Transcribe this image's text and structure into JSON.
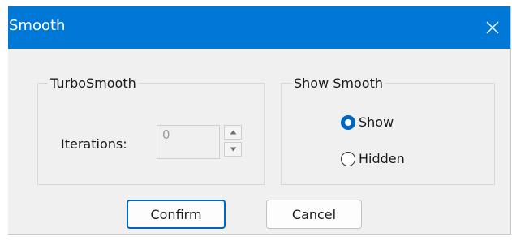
{
  "dialog": {
    "title": "Smooth"
  },
  "turbosmooth": {
    "legend": "TurboSmooth",
    "iterations_label": "Iterations:",
    "iterations_value": "0"
  },
  "show_smooth": {
    "legend": "Show Smooth",
    "options": [
      {
        "label": "Show",
        "selected": true
      },
      {
        "label": "Hidden",
        "selected": false
      }
    ]
  },
  "buttons": {
    "confirm": "Confirm",
    "cancel": "Cancel"
  },
  "colors": {
    "titlebar": "#0078d7",
    "accent": "#0067c0",
    "dialog_bg": "#f0f0f0"
  },
  "icons": {
    "close": "close-icon",
    "spin_up": "triangle-up-icon",
    "spin_down": "triangle-down-icon",
    "radio_on": "radio-checked-icon",
    "radio_off": "radio-unchecked-icon"
  }
}
